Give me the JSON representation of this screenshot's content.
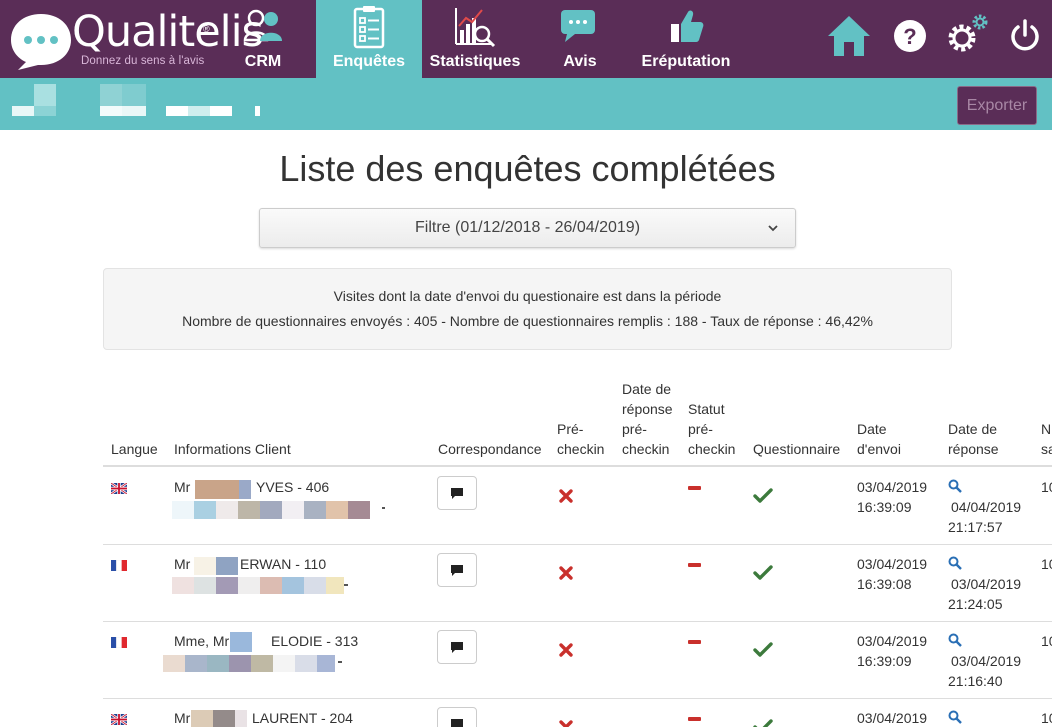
{
  "app": {
    "logo_text": "Qualitelis",
    "logo_reg": "®",
    "logo_tagline": "Donnez du sens à l'avis"
  },
  "nav": {
    "items": [
      {
        "label": "CRM",
        "icon": "crm-people-icon"
      },
      {
        "label": "Enquêtes",
        "icon": "clipboard-checklist-icon",
        "active": true
      },
      {
        "label": "Statistiques",
        "icon": "chart-magnifier-icon"
      },
      {
        "label": "Avis",
        "icon": "chat-bubbles-icon"
      },
      {
        "label": "Eréputation",
        "icon": "thumbs-up-icon"
      }
    ],
    "utility_icons": [
      "home-icon",
      "help-icon",
      "settings-icon",
      "power-icon"
    ]
  },
  "toolbar": {
    "export_label": "Exporter"
  },
  "page": {
    "title": "Liste des enquêtes complétées",
    "filter_label": "Filtre (01/12/2018 - 26/04/2019)"
  },
  "summary": {
    "line1": "Visites dont la date d'envoi du questionaire est dans la période",
    "line2": "Nombre de questionnaires envoyés : 405 - Nombre de questionnaires remplis : 188 - Taux de réponse : 46,42%"
  },
  "table": {
    "headers": {
      "langue": "Langue",
      "client": "Informations Client",
      "correspondance": "Correspondance",
      "precheckin_1": "Pré-",
      "precheckin_2": "checkin",
      "date_rep_pre_1": "Date de",
      "date_rep_pre_2": "réponse",
      "date_rep_pre_3": "pré-",
      "date_rep_pre_4": "checkin",
      "statut_pre_1": "Statut",
      "statut_pre_2": "pré-",
      "statut_pre_3": "checkin",
      "questionnaire": "Questionnaire",
      "date_envoi_1": "Date",
      "date_envoi_2": "d'envoi",
      "date_reponse_1": "Date de",
      "date_reponse_2": "réponse",
      "next_1": "N",
      "next_2": "sa"
    },
    "rows": [
      {
        "langue": "en",
        "civility": "Mr",
        "name": "YVES - 406",
        "envoi_date": "03/04/2019",
        "envoi_time": "16:39:09",
        "rep_date": "04/04/2019",
        "rep_time": "21:17:57",
        "next": "10"
      },
      {
        "langue": "fr",
        "civility": "Mr",
        "name": "ERWAN - 110",
        "envoi_date": "03/04/2019",
        "envoi_time": "16:39:08",
        "rep_date": "03/04/2019",
        "rep_time": "21:24:05",
        "next": "10"
      },
      {
        "langue": "fr",
        "civility": "Mme, Mr",
        "name": "ELODIE - 313",
        "envoi_date": "03/04/2019",
        "envoi_time": "16:39:09",
        "rep_date": "03/04/2019",
        "rep_time": "21:16:40",
        "next": "10"
      },
      {
        "langue": "en",
        "civility": "Mr",
        "name": "LAURENT - 204",
        "envoi_date": "03/04/2019",
        "envoi_time": "",
        "rep_date": "",
        "rep_time": "",
        "next": "10"
      }
    ]
  },
  "colors": {
    "nav_bg": "#5a2d57",
    "accent_teal": "#62c1c4",
    "status_red": "#c9302c",
    "status_green": "#3c7a3c",
    "search_blue": "#2a6fb5"
  }
}
